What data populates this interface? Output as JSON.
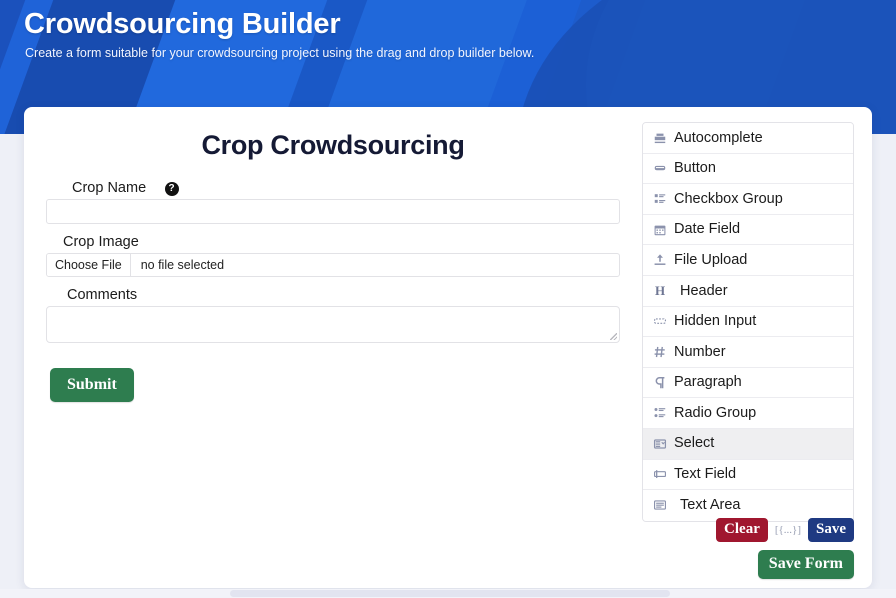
{
  "header": {
    "title": "Crowdsourcing Builder",
    "subtitle": "Create a form suitable for your crowdsourcing project using the drag and drop builder below.",
    "bg_color": "#1c60d6"
  },
  "form_preview": {
    "title": "Crop Crowdsourcing",
    "fields": [
      {
        "label": "Crop Name",
        "type": "text",
        "value": "",
        "placeholder": "",
        "has_help_icon": true,
        "help_icon": "question-circle-icon"
      },
      {
        "label": "Crop Image",
        "type": "file",
        "button_label": "Choose File",
        "file_status": "no file selected"
      },
      {
        "label": "Comments",
        "type": "textarea",
        "value": "",
        "placeholder": ""
      }
    ],
    "submit_label": "Submit",
    "submit_color": "#2e7d4f"
  },
  "palette": {
    "items": [
      {
        "label": "Autocomplete",
        "icon": "autocomplete-icon"
      },
      {
        "label": "Button",
        "icon": "button-icon"
      },
      {
        "label": "Checkbox Group",
        "icon": "checkbox-group-icon"
      },
      {
        "label": "Date Field",
        "icon": "calendar-icon"
      },
      {
        "label": "File Upload",
        "icon": "upload-icon"
      },
      {
        "label": "Header",
        "icon": "heading-icon"
      },
      {
        "label": "Hidden Input",
        "icon": "hidden-input-icon"
      },
      {
        "label": "Number",
        "icon": "hash-icon"
      },
      {
        "label": "Paragraph",
        "icon": "pilcrow-icon"
      },
      {
        "label": "Radio Group",
        "icon": "radio-group-icon"
      },
      {
        "label": "Select",
        "icon": "select-icon"
      },
      {
        "label": "Text Field",
        "icon": "text-field-icon"
      },
      {
        "label": "Text Area",
        "icon": "text-area-icon"
      }
    ],
    "hovered_index": 10
  },
  "actions": {
    "clear_label": "Clear",
    "clear_color": "#a0172f",
    "json_label": "[{...}]",
    "save_label": "Save",
    "save_color": "#1f3a82",
    "save_form_label": "Save Form",
    "save_form_color": "#2e7d4f"
  }
}
